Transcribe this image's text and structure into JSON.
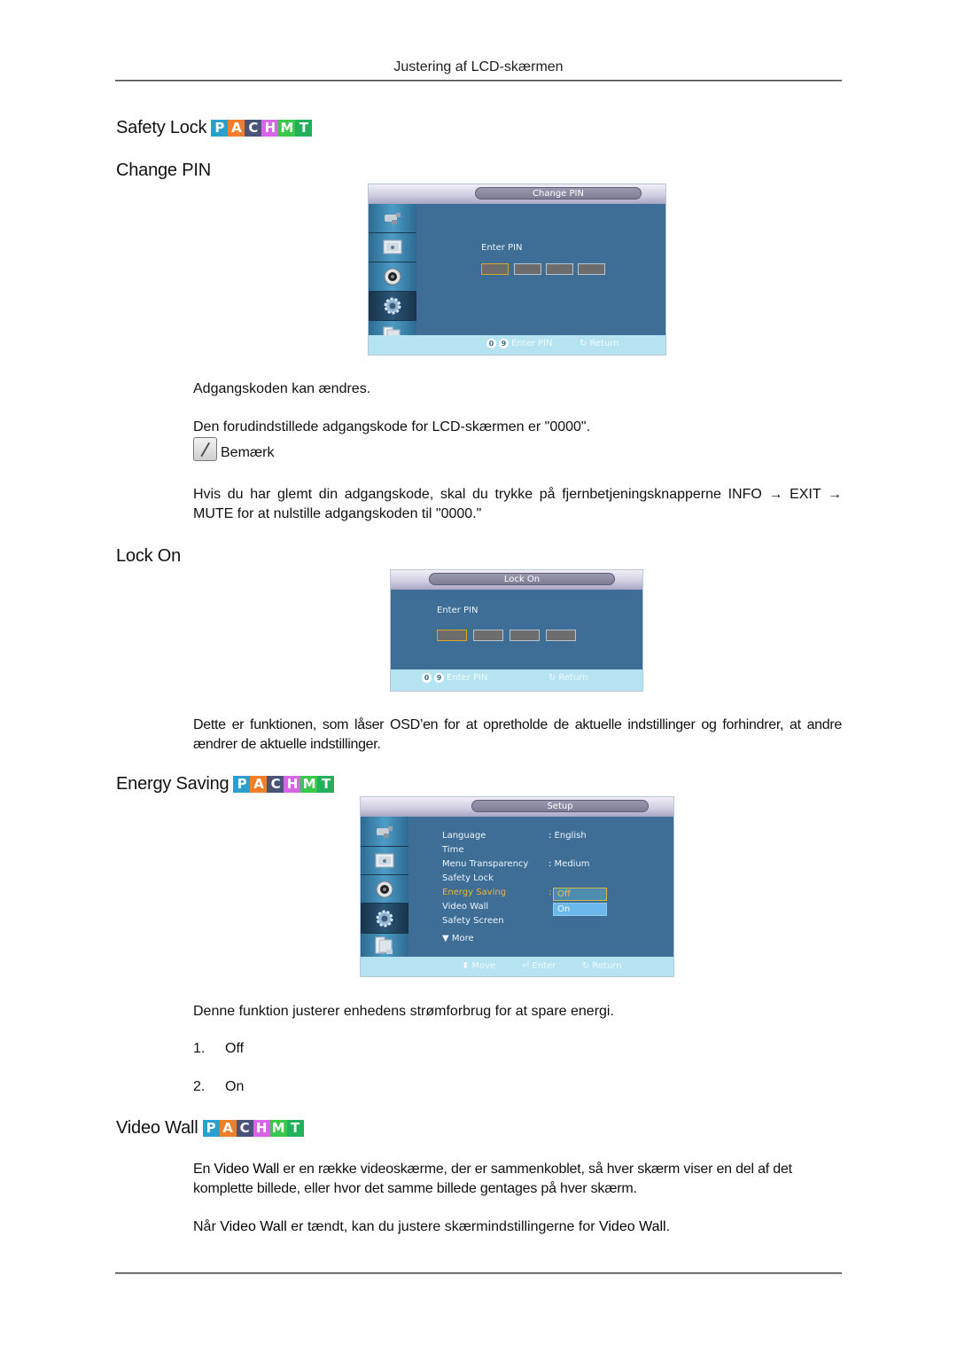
{
  "header": {
    "running_title": "Justering af LCD-skærmen"
  },
  "badge": {
    "letters": [
      "P",
      "A",
      "C",
      "H",
      "M",
      "T"
    ],
    "colors": [
      "#2a9fd0",
      "#f07f2a",
      "#4a5478",
      "#d865e8",
      "#38c94a",
      "#22b05a"
    ]
  },
  "sections": {
    "safety_lock": {
      "title": "Safety Lock"
    },
    "change_pin": {
      "title": "Change PIN",
      "osd": {
        "title": "Change PIN",
        "enter_label": "Enter PIN",
        "footer_range_start": "0",
        "footer_range_end": "9",
        "footer_enter": "Enter PIN",
        "footer_return": "Return"
      },
      "paragraphs": [
        "Adgangskoden kan ændres.",
        "Den forudindstillede adgangskode for LCD-skærmen er \"0000\"."
      ],
      "note_label": "Bemærk",
      "note_text": "Hvis du har glemt din adgangskode, skal du trykke på fjernbetjeningsknapperne INFO → EXIT → MUTE for at nulstille adgangskoden til \"0000.\""
    },
    "lock_on": {
      "title": "Lock On",
      "osd": {
        "title": "Lock On",
        "enter_label": "Enter PIN",
        "footer_range_start": "0",
        "footer_range_end": "9",
        "footer_enter": "Enter PIN",
        "footer_return": "Return"
      },
      "paragraph": "Dette er funktionen, som låser OSD’en for at opretholde de aktuelle indstillinger og forhindrer, at andre ændrer de aktuelle indstillinger."
    },
    "energy_saving": {
      "title": "Energy Saving",
      "osd": {
        "title": "Setup",
        "menu": [
          {
            "label": "Language",
            "value": ": English"
          },
          {
            "label": "Time",
            "value": ""
          },
          {
            "label": "Menu Transparency",
            "value": ": Medium"
          },
          {
            "label": "Safety Lock",
            "value": ""
          },
          {
            "label": "Energy Saving",
            "value": ":"
          },
          {
            "label": "Video Wall",
            "value": ""
          },
          {
            "label": "Safety Screen",
            "value": ""
          },
          {
            "label": "▼ More",
            "value": ""
          }
        ],
        "dropdown_options": [
          "Off",
          "On"
        ],
        "selected_option": "Off",
        "footer_move": "Move",
        "footer_enter": "Enter",
        "footer_return": "Return"
      },
      "paragraph": "Denne funktion justerer enhedens strømforbrug for at spare energi.",
      "list": [
        {
          "num": "1.",
          "label": "Off"
        },
        {
          "num": "2.",
          "label": "On"
        }
      ]
    },
    "video_wall": {
      "title": "Video Wall",
      "p1_pre": "En ",
      "p1_term": "Video Wall",
      "p1_post": " er en række videoskærme, der er sammenkoblet, så hver skærm viser en del af det komplette billede, eller hvor det samme billede gentages på hver skærm.",
      "p2_pre": "Når ",
      "p2_term1": "Video Wall",
      "p2_mid": " er tændt, kan du justere skærmindstillingerne for ",
      "p2_term2": "Video Wall",
      "p2_post": "."
    }
  }
}
